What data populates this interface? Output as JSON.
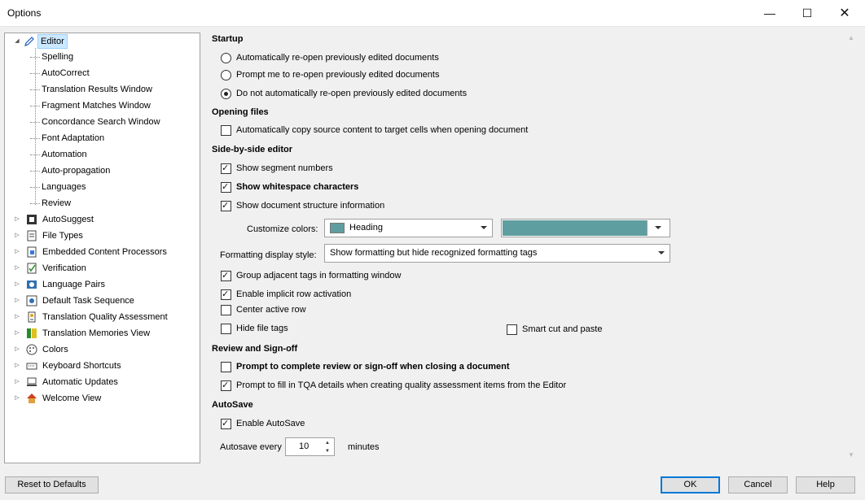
{
  "window": {
    "title": "Options"
  },
  "tree": {
    "root": {
      "label": "Editor"
    },
    "editor_children": [
      "Spelling",
      "AutoCorrect",
      "Translation Results Window",
      "Fragment Matches Window",
      "Concordance Search Window",
      "Font Adaptation",
      "Automation",
      "Auto-propagation",
      "Languages",
      "Review"
    ],
    "top_items": [
      {
        "label": "AutoSuggest",
        "icon": "autosuggest-icon"
      },
      {
        "label": "File Types",
        "icon": "file-types-icon"
      },
      {
        "label": "Embedded Content Processors",
        "icon": "embedded-content-icon"
      },
      {
        "label": "Verification",
        "icon": "verification-icon"
      },
      {
        "label": "Language Pairs",
        "icon": "language-pairs-icon"
      },
      {
        "label": "Default Task Sequence",
        "icon": "task-sequence-icon"
      },
      {
        "label": "Translation Quality Assessment",
        "icon": "tqa-icon"
      },
      {
        "label": "Translation Memories View",
        "icon": "tm-view-icon"
      },
      {
        "label": "Colors",
        "icon": "palette-icon"
      },
      {
        "label": "Keyboard Shortcuts",
        "icon": "keyboard-icon"
      },
      {
        "label": "Automatic Updates",
        "icon": "updates-icon"
      },
      {
        "label": "Welcome View",
        "icon": "home-icon"
      }
    ]
  },
  "startup": {
    "heading": "Startup",
    "options": [
      {
        "label": "Automatically re-open previously edited documents",
        "selected": false
      },
      {
        "label": "Prompt me to re-open previously edited documents",
        "selected": false
      },
      {
        "label": "Do not automatically re-open previously edited documents",
        "selected": true
      }
    ]
  },
  "opening_files": {
    "heading": "Opening files",
    "copy_source": {
      "label": "Automatically copy source content to target cells when opening document",
      "checked": false
    }
  },
  "side_by_side": {
    "heading": "Side-by-side editor",
    "show_segment_numbers": {
      "label": "Show segment numbers",
      "checked": true
    },
    "show_whitespace": {
      "label": "Show whitespace characters",
      "checked": true
    },
    "show_structure": {
      "label": "Show document structure information",
      "checked": true
    },
    "customize_colors_label": "Customize colors:",
    "color_element": "Heading",
    "color_value": "#5f9ea0",
    "formatting_label": "Formatting display style:",
    "formatting_value": "Show formatting but hide recognized formatting tags",
    "group_tags": {
      "label": "Group adjacent tags in formatting window",
      "checked": true
    },
    "implicit_row": {
      "label": "Enable implicit row activation",
      "checked": true
    },
    "center_row": {
      "label": "Center active row",
      "checked": false
    },
    "hide_file_tags": {
      "label": "Hide file tags",
      "checked": false
    },
    "smart_cut": {
      "label": "Smart cut and paste",
      "checked": false
    }
  },
  "review": {
    "heading": "Review and Sign-off",
    "prompt_complete": {
      "label": "Prompt to complete review or sign-off when closing a document",
      "checked": false
    },
    "prompt_tqa": {
      "label": "Prompt to fill in TQA details when creating quality assessment items from the Editor",
      "checked": true
    }
  },
  "autosave": {
    "heading": "AutoSave",
    "enable": {
      "label": "Enable AutoSave",
      "checked": true
    },
    "every_label": "Autosave every",
    "minutes_value": "10",
    "minutes_label": "minutes"
  },
  "buttons": {
    "reset": "Reset to Defaults",
    "ok": "OK",
    "cancel": "Cancel",
    "help": "Help"
  }
}
